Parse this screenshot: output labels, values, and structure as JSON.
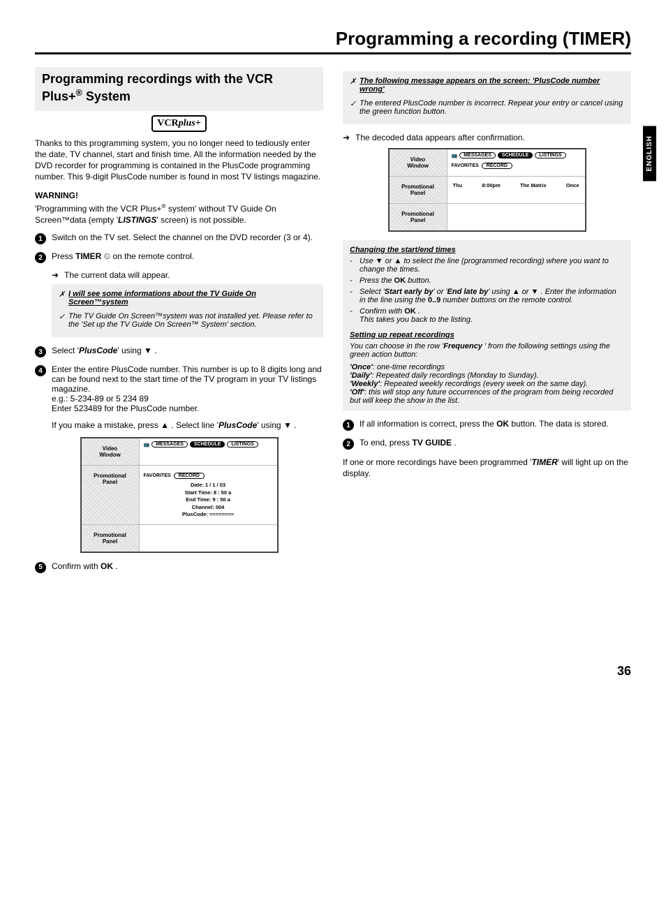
{
  "page_title": "Programming a recording (TIMER)",
  "side_tab": "ENGLISH",
  "page_number": "36",
  "left": {
    "section_heading_pre": "Programming recordings with the VCR Plus+",
    "section_heading_suf": " System",
    "logo_vcr": "VCR",
    "logo_plus": "plus+",
    "intro": "Thanks to this programming system, you no longer need to tediously enter the date, TV channel, start and finish time. All the information needed by the DVD recorder for programming is contained in the PlusCode programming number. This 9-digit PlusCode number is found in most TV listings magazine.",
    "warning_label": "WARNING!",
    "warning_text_a": "'Programming with the VCR Plus+",
    "warning_text_b": " system' without TV Guide On Screen™data (empty '",
    "warning_text_c": "LISTINGS",
    "warning_text_d": "' screen) is not possible.",
    "step1": "Switch on the TV set. Select the channel on the DVD recorder (3 or 4).",
    "step2_pre": "Press ",
    "step2_key": "TIMER",
    "step2_clock": " ⏲ ",
    "step2_suf": "on the remote control.",
    "step2_sub": "The current data will appear.",
    "grey1_head": "I will see some informations about the TV Guide On Screen™system",
    "grey1_body": "The TV Guide On Screen™system was not installed yet. Please refer to the 'Set up the TV Guide On Screen™ System' section.",
    "step3_pre": "Select '",
    "step3_key": "PlusCode",
    "step3_suf": "' using ",
    "step4_a": "Enter the entire PlusCode number. This number is up to 8 digits long and can be found next to the start time of the TV program in your TV listings magazine.",
    "step4_b": "e.g.: 5-234-89 or 5 234 89",
    "step4_c": "Enter 523489 for the PlusCode number.",
    "step4_mistake_a": "If you make a mistake, press ",
    "step4_mistake_b": " . Select line '",
    "step4_mistake_key": "PlusCode",
    "step4_mistake_c": "' using ",
    "screen1": {
      "vw": "Video\nWindow",
      "pp": "Promotional\nPanel",
      "tabs": [
        "MESSAGES",
        "SCHEDULE",
        "LISTINGS"
      ],
      "fav": "FAVORITES",
      "rec": "RECORD",
      "lines": [
        "Date: 1 / 1 / 03",
        "Start Time: 8 : 50 a",
        "End Time: 9 : 50 a",
        "Channel: 004",
        "PlusCode: ========"
      ]
    },
    "step5_pre": "Confirm with ",
    "step5_key": "OK",
    "step5_suf": " ."
  },
  "right": {
    "grey2_head": "The following message appears on the screen: 'PlusCode number wrong'",
    "grey2_body": "The entered PlusCode number is incorrect. Repeat your entry or cancel using the green function button.",
    "decoded": "The decoded data appears after confirmation.",
    "screen2": {
      "vw": "Video\nWindow",
      "pp": "Promotional\nPanel",
      "tabs": [
        "MESSAGES",
        "SCHEDULE",
        "LISTINGS"
      ],
      "fav": "FAVORITES",
      "rec": "RECORD",
      "rec_row": [
        "Thu",
        "8:00pm",
        "The Matrix",
        "Once"
      ]
    },
    "grey3_head": "Changing the start/end times",
    "grey3_l1a": "Use ",
    "grey3_l1b": " or ",
    "grey3_l1c": " to select the line (programmed recording) where you want to change the times.",
    "grey3_l2a": "Press the ",
    "grey3_l2b": "OK",
    "grey3_l2c": " button.",
    "grey3_l3a": "Select '",
    "grey3_l3b": "Start early by",
    "grey3_l3c": "' or '",
    "grey3_l3d": "End late by",
    "grey3_l3e": "' using ",
    "grey3_l3f": " or ",
    "grey3_l3g": " . Enter the information in the line using the ",
    "grey3_l3h": "0..9",
    "grey3_l3i": " number buttons on the remote control.",
    "grey3_l4a": "Confirm with ",
    "grey3_l4b": "OK",
    "grey3_l4c": " .",
    "grey3_l4d": "This takes you back to the listing.",
    "grey4_head": "Setting up repeat recordings",
    "grey4_intro_a": "You can choose in the row '",
    "grey4_intro_b": "Frequency ",
    "grey4_intro_c": "' from the following settings using the green action button:",
    "grey4_once_k": "'Once'",
    "grey4_once_v": ": one-time recordings",
    "grey4_daily_k": "'Daily'",
    "grey4_daily_v": ": Repeated daily recordings (Monday to Sunday).",
    "grey4_weekly_k": "'Weekly'",
    "grey4_weekly_v": ": Repeated weekly recordings (every week on the same day).",
    "grey4_off_k": "'Off'",
    "grey4_off_v": ": this will stop any future occurrences of the program from being recorded but will keep the show in the list.",
    "stepA_a": "If all information is correct, press the ",
    "stepA_b": "OK",
    "stepA_c": " button. The data is stored.",
    "stepB_a": "To end, press ",
    "stepB_b": "TV GUIDE",
    "stepB_c": " .",
    "final_a": "If one or more recordings have been programmed '",
    "final_b": "TIMER",
    "final_c": "' will light up on the display."
  }
}
